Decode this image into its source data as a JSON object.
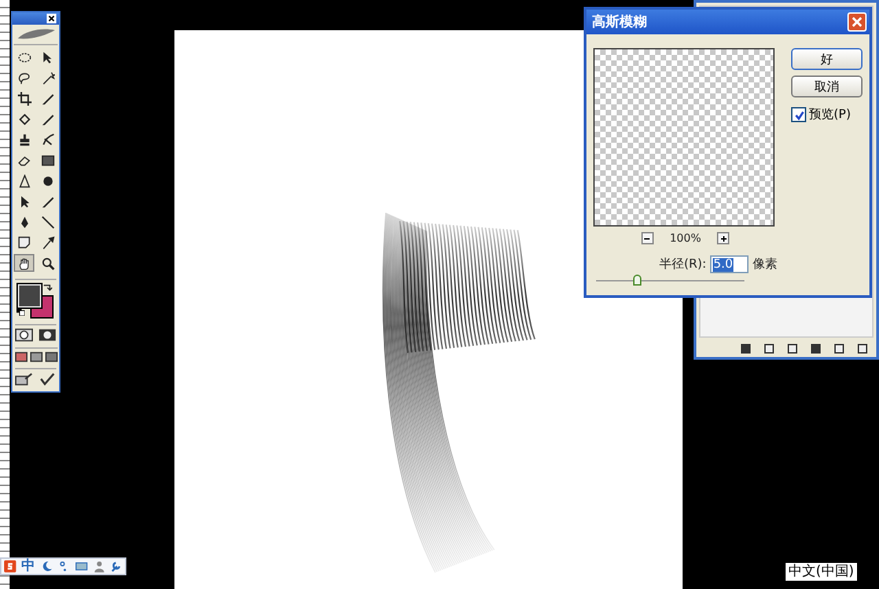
{
  "dialog": {
    "title": "高斯模糊",
    "buttons": [
      {
        "label": "好",
        "kind": "default"
      },
      {
        "label": "取消",
        "kind": "normal"
      }
    ],
    "preview_checkbox": {
      "label": "预览(P)",
      "checked": true
    },
    "zoom": {
      "value": "100%"
    },
    "radius": {
      "label": "半径(R):",
      "value": "5.0",
      "unit": "像素"
    },
    "slider": {
      "level": 0.28
    }
  },
  "ime_bar": {
    "mode": "中"
  },
  "language_indicator": "中文(中国)"
}
